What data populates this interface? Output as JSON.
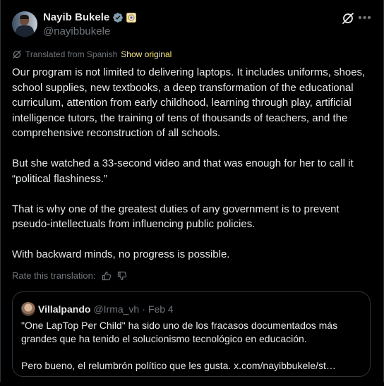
{
  "author": {
    "display_name": "Nayib Bukele",
    "handle": "@nayibbukele"
  },
  "translation": {
    "label": "Translated from Spanish",
    "show_original": "Show original",
    "rate_label": "Rate this translation:"
  },
  "post": {
    "paragraphs": [
      "Our program is not limited to delivering laptops. It includes uniforms, shoes, school supplies, new textbooks, a deep transformation of the educational curriculum, attention from early childhood, learning through play, artificial intelligence tutors, the training of tens of thousands of teachers, and the comprehensive reconstruction of all schools.",
      "But she watched a 33-second video and that was enough for her to call it “political flashiness.”",
      "That is why one of the greatest duties of any government is to prevent pseudo-intellectuals from influencing public policies.",
      "With backward minds, no progress is possible."
    ]
  },
  "quote": {
    "display_name": "Villalpando",
    "handle": "@Irma_vh",
    "separator": "·",
    "date": "Feb 4",
    "paragraphs": [
      "\"One LapTop Per Child\" ha sido uno de los fracasos documentados más grandes que ha tenido el solucionismo tecnológico en educación.",
      "Pero bueno, el relumbrón político que les gusta. x.com/nayibbukele/st…"
    ]
  },
  "icons": {
    "verified": "verified-badge-icon",
    "affiliation": "affiliation-badge-icon",
    "grok": "grok-icon",
    "more": "more-icon",
    "translate": "translate-icon",
    "thumbs_up": "thumbs-up-icon",
    "thumbs_down": "thumbs-down-icon"
  },
  "colors": {
    "background": "#000000",
    "text": "#e7e9ea",
    "muted": "#71767b",
    "verified": "#829aab",
    "link": "#f7e98d",
    "border": "#2f3336"
  }
}
